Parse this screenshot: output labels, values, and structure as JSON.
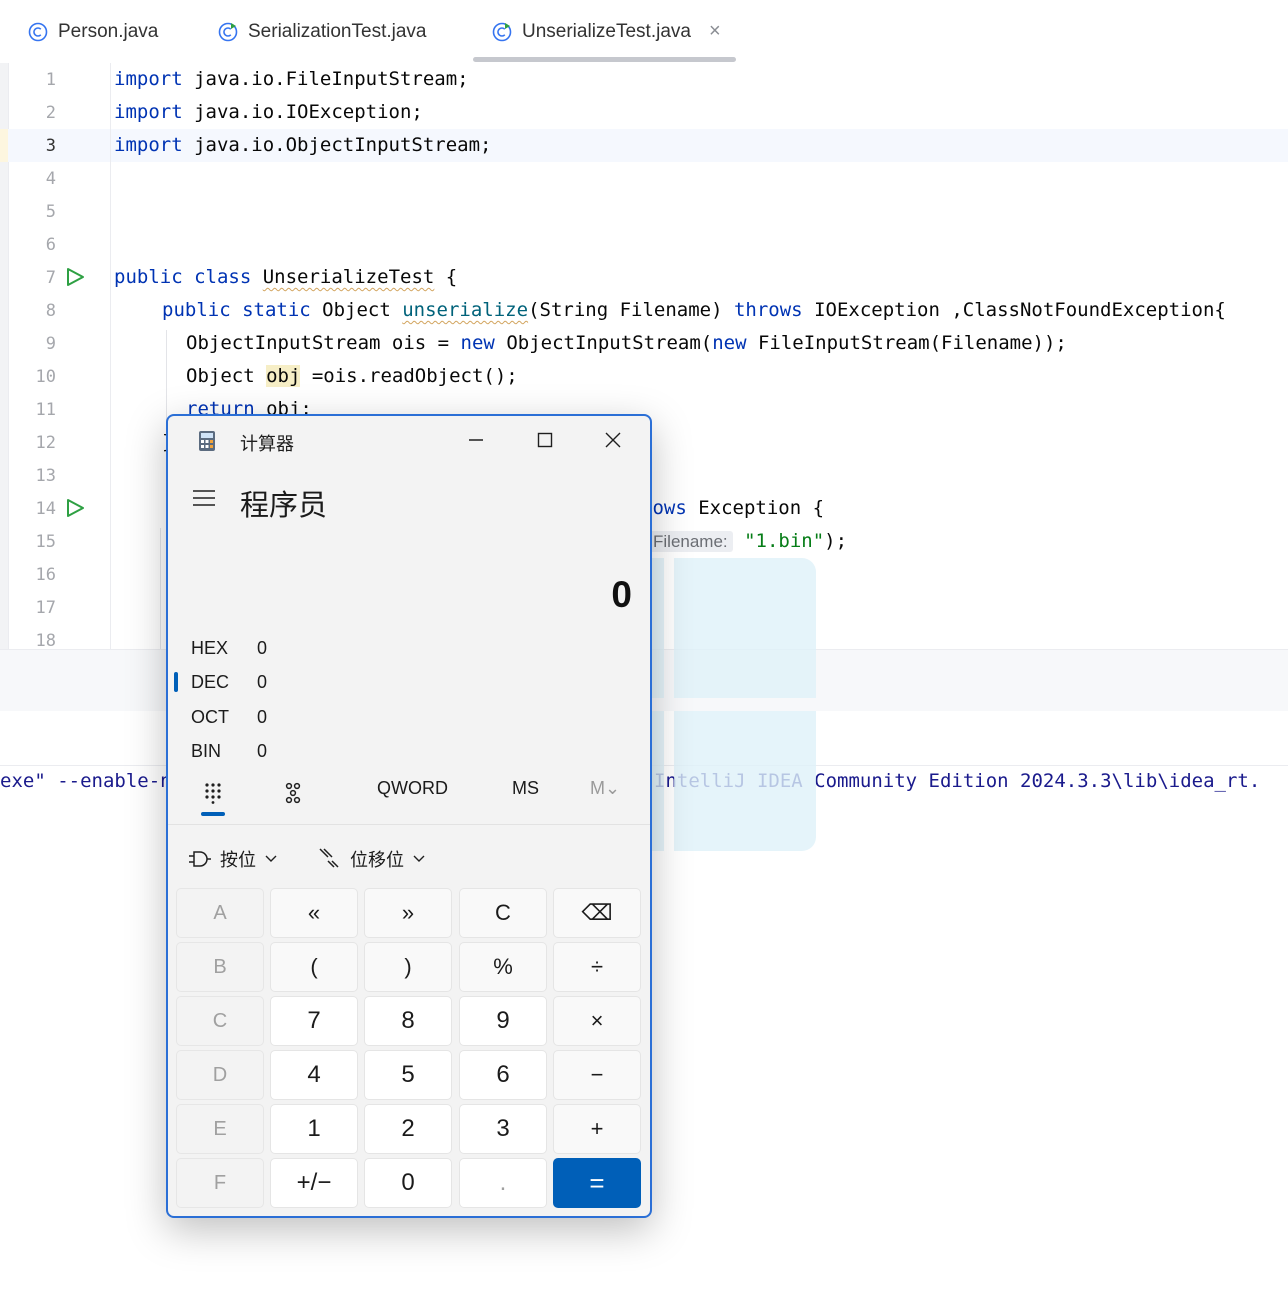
{
  "ide": {
    "tabs": [
      {
        "label": "Person.java"
      },
      {
        "label": "SerializationTest.java"
      },
      {
        "label": "UnserializeTest.java"
      }
    ],
    "line_numbers": [
      "1",
      "2",
      "3",
      "4",
      "5",
      "6",
      "7",
      "8",
      "9",
      "10",
      "11",
      "12",
      "13",
      "14",
      "15",
      "16",
      "17",
      "18"
    ],
    "code": {
      "l1_kw": "import",
      "l1_rest": " java.io.FileInputStream;",
      "l2_kw": "import",
      "l2_rest": " java.io.IOException;",
      "l3_kw": "import",
      "l3_rest": " java.io.ObjectInputStream;",
      "l7_kw": "public class",
      "l7_name": "UnserializeTest",
      "l7_rest": " {",
      "l8_kw": "public static",
      "l8_type": " Object ",
      "l8_fn": "unserialize",
      "l8_params": "(String Filename) ",
      "l8_throws": "throws",
      "l8_rest": " IOException ,ClassNotFoundException{",
      "l9_a": "ObjectInputStream ois = ",
      "l9_new1": "new",
      "l9_b": " ObjectInputStream(",
      "l9_new2": "new",
      "l9_c": " FileInputStream(Filename));",
      "l10_a": "Object ",
      "l10_var": "obj",
      "l10_b": " =ois.readObject();",
      "l11_kw": "return",
      "l11_rest": " obj;",
      "l12": "}",
      "l14_a": "rows",
      "l14_b": " Exception {",
      "l15_hint": "Filename:",
      "l15_str": "\"1.bin\"",
      "l15_rest": ");"
    },
    "console": {
      "left": "exe\" --enable-n",
      "right": "IntelliJ IDEA Community Edition 2024.3.3\\lib\\idea_rt."
    }
  },
  "calculator": {
    "title": "计算器",
    "mode": "程序员",
    "display": "0",
    "radix": [
      {
        "label": "HEX",
        "value": "0"
      },
      {
        "label": "DEC",
        "value": "0"
      },
      {
        "label": "OCT",
        "value": "0"
      },
      {
        "label": "BIN",
        "value": "0"
      }
    ],
    "tools": {
      "qword": "QWORD",
      "ms": "MS",
      "mv": "M⌄"
    },
    "bitwise_label": "按位",
    "bitshift_label": "位移位",
    "keys": [
      [
        "A",
        "«",
        "»",
        "C",
        "⌫"
      ],
      [
        "B",
        "(",
        ")",
        "%",
        "÷"
      ],
      [
        "C",
        "7",
        "8",
        "9",
        "×"
      ],
      [
        "D",
        "4",
        "5",
        "6",
        "−"
      ],
      [
        "E",
        "1",
        "2",
        "3",
        "+"
      ],
      [
        "F",
        "+/−",
        "0",
        ".",
        "="
      ]
    ]
  }
}
